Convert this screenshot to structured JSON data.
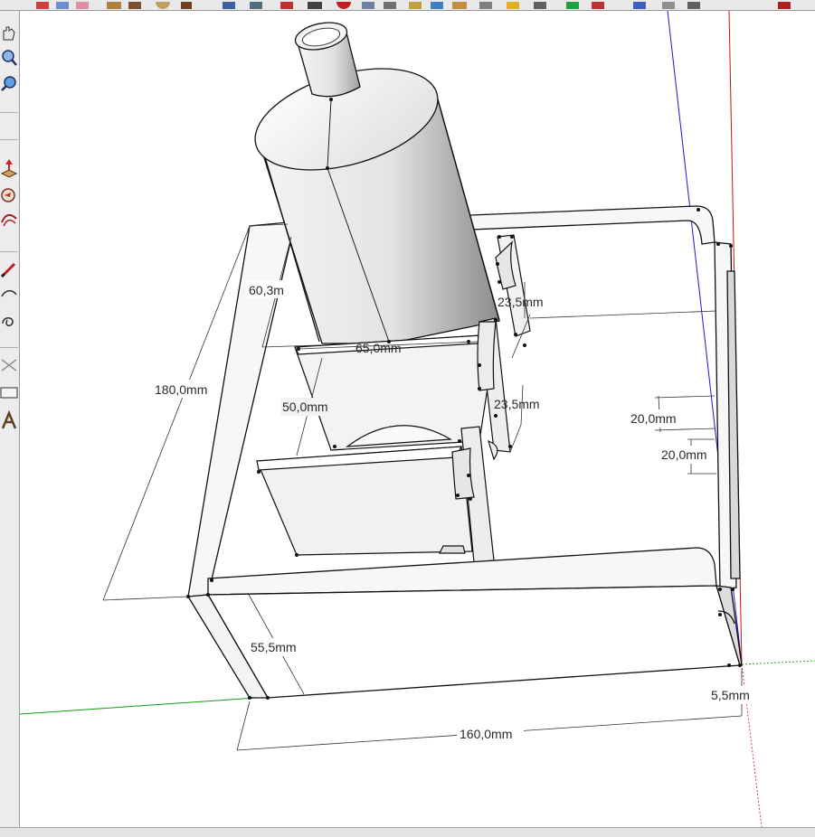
{
  "toolbar": {
    "top_icons": [
      "axes-icon",
      "orbit-icon",
      "eraser-icon",
      "folder-icon",
      "paint-bucket-icon",
      "rotate-icon",
      "hand-icon",
      "window-icon",
      "camera-icon",
      "material-icon",
      "undo-icon",
      "zoom-icon",
      "layers-icon",
      "component-icon",
      "section-icon",
      "shadow-icon",
      "face-style-icon",
      "fog-icon",
      "position-camera-icon",
      "walk-icon",
      "look-around-icon",
      "zoom-window-icon",
      "zoom-extents-icon",
      "previous-view-icon",
      "next-view-icon",
      "close-icon"
    ],
    "left_icons": [
      "pan-icon",
      "zoom-icon",
      "zoom-extents-icon",
      "push-pull-icon",
      "follow-me-icon",
      "offset-icon",
      "pencil-icon",
      "arc-icon",
      "freehand-icon",
      "protractor-icon",
      "text-icon",
      "3d-text-icon"
    ]
  },
  "dimensions": {
    "d180": "180,0mm",
    "d60": "60,3m",
    "d65": "65,0mm",
    "d50": "50,0mm",
    "d23a": "23,5mm",
    "d23b": "23,5mm",
    "d20a": "20,0mm",
    "d20b": "20,0mm",
    "d55": "55,5mm",
    "d160": "160,0mm",
    "d5": "5,5mm"
  },
  "colors": {
    "background": "#ffffff",
    "axis_red": "#cc0000",
    "axis_green": "#008800",
    "axis_blue": "#0000cc",
    "edge": "#111111"
  }
}
